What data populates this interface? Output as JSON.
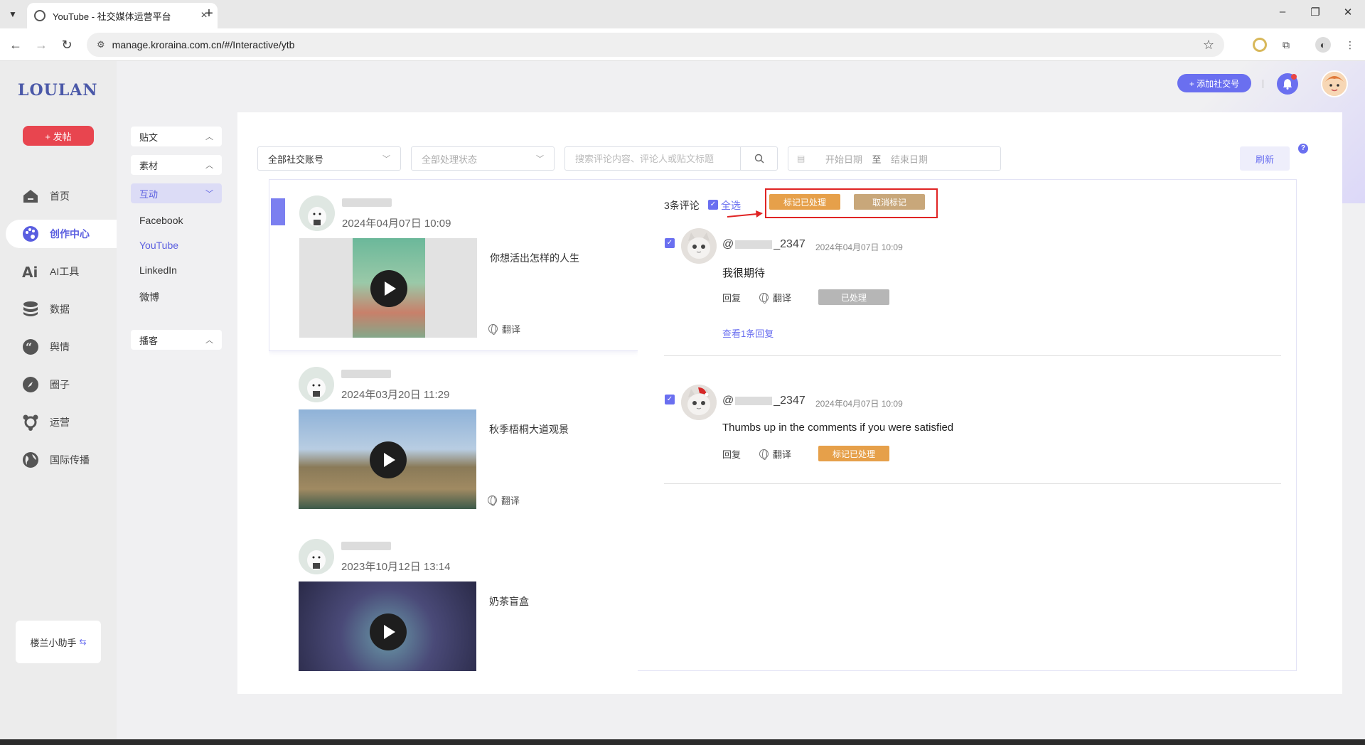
{
  "browser": {
    "tab_title": "YouTube - 社交媒体运营平台",
    "url": "manage.kroraina.com.cn/#/Interactive/ytb"
  },
  "sidebar": {
    "logo": "LOULAN",
    "post_button": "+ 发帖",
    "items": [
      {
        "label": "首页",
        "icon": "home-icon"
      },
      {
        "label": "创作中心",
        "icon": "palette-icon",
        "active": true
      },
      {
        "label": "AI工具",
        "icon": "ai-icon"
      },
      {
        "label": "数据",
        "icon": "database-icon"
      },
      {
        "label": "舆情",
        "icon": "quote-icon"
      },
      {
        "label": "圈子",
        "icon": "compass-icon"
      },
      {
        "label": "运营",
        "icon": "network-icon"
      },
      {
        "label": "国际传播",
        "icon": "globe-icon"
      }
    ],
    "helper": "楼兰小助手"
  },
  "subnav": {
    "groups": [
      "贴文",
      "素材",
      "互动",
      "播客"
    ],
    "links": [
      "Facebook",
      "YouTube",
      "LinkedIn",
      "微博"
    ]
  },
  "header": {
    "add_account": "+ 添加社交号"
  },
  "filters": {
    "account": "全部社交账号",
    "status": "全部处理状态",
    "search_placeholder": "搜索评论内容、评论人或贴文标题",
    "start_date": "开始日期",
    "end_date": "结束日期",
    "date_sep": "至",
    "refresh": "刷新",
    "help": "?"
  },
  "posts": [
    {
      "time": "2024年04月07日 10:09",
      "caption": "你想活出怎样的人生",
      "translate": "翻译"
    },
    {
      "time": "2024年03月20日 11:29",
      "caption": "秋季梧桐大道观景",
      "translate": "翻译"
    },
    {
      "time": "2023年10月12日 13:14",
      "caption": "奶茶盲盒",
      "translate": "翻译"
    }
  ],
  "comments_panel": {
    "count": "3条评论",
    "select_all": "全选",
    "mark_done": "标记已处理",
    "unmark": "取消标记",
    "comments": [
      {
        "name_prefix": "@",
        "name_suffix": "_2347",
        "time": "2024年04月07日 10:09",
        "text": "我很期待",
        "reply": "回复",
        "translate": "翻译",
        "status": "已处理",
        "more": "查看1条回复"
      },
      {
        "name_prefix": "@",
        "name_suffix": "_2347",
        "time": "2024年04月07日 10:09",
        "text": "Thumbs up in the comments if you were satisfied",
        "reply": "回复",
        "translate": "翻译",
        "status": "标记已处理"
      }
    ]
  },
  "colors": {
    "accent": "#6a6ff0",
    "post_button": "#e8454f",
    "mark_done": "#e6a04a",
    "unmark": "#c8a77a",
    "processed": "#b6b6b6",
    "highlight_box": "#e02424"
  }
}
